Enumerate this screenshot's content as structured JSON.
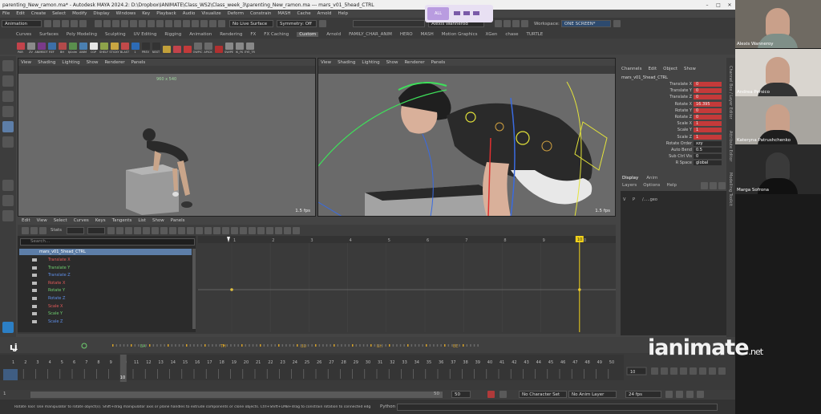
{
  "app": {
    "title": "parenting_New_ramon.ma* - Autodesk MAYA 2024.2: D:\\Dropbox\\IANIMATE\\Class_WS2\\Class_week_3\\parenting_New_ramon.ma --- mars_v01_5head_CTRL"
  },
  "menubar": [
    "File",
    "Edit",
    "Create",
    "Select",
    "Modify",
    "Display",
    "Windows",
    "Key",
    "Playback",
    "Audio",
    "Visualize",
    "Deform",
    "Constrain",
    "MASH",
    "Cache",
    "Arnold",
    "Help"
  ],
  "statusline": {
    "mode": "Animation",
    "live_surface": "No Live Surface",
    "symmetry": "Symmetry: Off",
    "user": "Alexis Wannerod",
    "workspace_label": "Workspace:",
    "workspace": "ONE SCREEN*"
  },
  "overlay": {
    "label": "ALL"
  },
  "shelf_tabs": [
    "Curves",
    "Surfaces",
    "Poly Modeling",
    "Sculpting",
    "UV Editing",
    "Rigging",
    "Animation",
    "Rendering",
    "FX",
    "FX Caching",
    "Custom",
    "Arnold",
    "FAMILY_CHAR_ANIM",
    "HERO",
    "MASH",
    "Motion Graphics",
    "XGen",
    "chase",
    "TURTLE"
  ],
  "active_shelf": "Custom",
  "shelf_icons": [
    {
      "label": "PAR",
      "color": "#c2434b"
    },
    {
      "label": "ZV",
      "color": "#8a8a8a"
    },
    {
      "label": "ANIMBOT",
      "color": "#7a3a8a"
    },
    {
      "label": "REF",
      "color": "#3d6fa8"
    },
    {
      "label": "BH",
      "color": "#b24a4a"
    },
    {
      "label": "tjAnim",
      "color": "#5a8f4d"
    },
    {
      "label": "ANIM",
      "color": "#4a7fb0"
    },
    {
      "label": "CGP",
      "color": "#e6e6e6"
    },
    {
      "label": "SHELF",
      "color": "#8ea34a"
    },
    {
      "label": "STICKY",
      "color": "#c9a642"
    },
    {
      "label": "BLAST",
      "color": "#c14a4a"
    },
    {
      "label": "1",
      "color": "#2d6bb5"
    },
    {
      "label": "PREV",
      "color": "#333333"
    },
    {
      "label": "NEXT",
      "color": "#333333"
    },
    {
      "label": "",
      "color": "#c2a03a"
    },
    {
      "label": "",
      "color": "#c2434b"
    },
    {
      "label": "",
      "color": "#c23a3a"
    },
    {
      "label": "OWPIC",
      "color": "#6a6a6a"
    },
    {
      "label": "APICK",
      "color": "#6a6a6a"
    },
    {
      "label": "",
      "color": "#b03030"
    },
    {
      "label": "SWIPE",
      "color": "#888888"
    },
    {
      "label": "IK_FK",
      "color": "#888888"
    },
    {
      "label": "EYE_TR",
      "color": "#888888"
    }
  ],
  "viewport_menu": [
    "View",
    "Shading",
    "Lighting",
    "Show",
    "Renderer",
    "Panels"
  ],
  "viewport_left": {
    "resolution": "960 x 540",
    "fps": "1.5 fps"
  },
  "viewport_right": {
    "fps": "1.5 fps"
  },
  "graph_editor": {
    "menu": [
      "Edit",
      "View",
      "Select",
      "Curves",
      "Keys",
      "Tangents",
      "List",
      "Show",
      "Panels"
    ],
    "stats_label": "Stats",
    "search_placeholder": "Search...",
    "object": "mars_v01_5head_CTRL",
    "channels": [
      {
        "name": "Translate X",
        "color": "#e35a5a"
      },
      {
        "name": "Translate Y",
        "color": "#6fcf6f"
      },
      {
        "name": "Translate Z",
        "color": "#5f8fe8"
      },
      {
        "name": "Rotate X",
        "color": "#e35a5a"
      },
      {
        "name": "Rotate Y",
        "color": "#6fcf6f"
      },
      {
        "name": "Rotate Z",
        "color": "#5f8fe8"
      },
      {
        "name": "Scale X",
        "color": "#e35a5a"
      },
      {
        "name": "Scale Y",
        "color": "#6fcf6f"
      },
      {
        "name": "Scale Z",
        "color": "#5f8fe8"
      }
    ],
    "frame_marks": [
      "1",
      "2",
      "3",
      "4",
      "5",
      "6",
      "7",
      "8",
      "9",
      "10"
    ],
    "current_frame": "10"
  },
  "channel_box": {
    "menu": [
      "Channels",
      "Edit",
      "Object",
      "Show"
    ],
    "object": "mars_v01_5head_CTRL",
    "attrs": [
      {
        "name": "Translate X",
        "value": "0",
        "keyed": true
      },
      {
        "name": "Translate Y",
        "value": "0",
        "keyed": true
      },
      {
        "name": "Translate Z",
        "value": "0",
        "keyed": true
      },
      {
        "name": "Rotate X",
        "value": "16.395",
        "keyed": true
      },
      {
        "name": "Rotate Y",
        "value": "0",
        "keyed": true
      },
      {
        "name": "Rotate Z",
        "value": "0",
        "keyed": true
      },
      {
        "name": "Scale X",
        "value": "1",
        "keyed": true
      },
      {
        "name": "Scale Y",
        "value": "1",
        "keyed": true
      },
      {
        "name": "Scale Z",
        "value": "1",
        "keyed": true
      },
      {
        "name": "Rotate Order",
        "value": "xzy",
        "keyed": false
      },
      {
        "name": "Auto Bend",
        "value": "0.5",
        "keyed": false
      },
      {
        "name": "Sub Ctrl Vis",
        "value": "0",
        "keyed": false
      },
      {
        "name": "R Space",
        "value": "global",
        "keyed": false
      }
    ],
    "layer_tabs": [
      "Display",
      "Anim"
    ],
    "layer_menu": [
      "Layers",
      "Options",
      "Help"
    ],
    "layer_row": {
      "v": "V",
      "p": "P",
      "name": "/.....geo"
    }
  },
  "timeline": {
    "markers": [
      {
        "label": "EA",
        "color": "#6fcf6f"
      },
      {
        "label": "TH",
        "color": "#d4a02a"
      },
      {
        "label": "BD",
        "color": "#d4a02a"
      },
      {
        "label": "BH",
        "color": "#d4a02a"
      },
      {
        "label": "BE",
        "color": "#d4a02a"
      }
    ],
    "ticks": [
      "1",
      "2",
      "3",
      "4",
      "5",
      "6",
      "7",
      "8",
      "9",
      "10",
      "11",
      "12",
      "13",
      "14",
      "15",
      "16",
      "17",
      "18",
      "19",
      "20",
      "21",
      "22",
      "23",
      "24",
      "25",
      "26",
      "27",
      "28",
      "29",
      "30",
      "31",
      "32",
      "33",
      "34",
      "35",
      "36",
      "37",
      "38",
      "39",
      "40",
      "41",
      "42",
      "43",
      "44",
      "45",
      "46",
      "47",
      "48",
      "49",
      "50"
    ],
    "current_frame": "10",
    "current_field": "10"
  },
  "range": {
    "start": "1",
    "start_inner": "1",
    "end_inner": "50",
    "end": "50",
    "character_set": "No Character Set",
    "anim_layer": "No Anim Layer",
    "fps": "24 fps"
  },
  "help": {
    "text": "Rotate Tool: Use manipulator to rotate object(s). Shift+drag manipulator axis or plane handles to extrude components or clone objects. Ctrl+Shift+LMB+drag to constrain rotation to connected edges. Use D or INSE",
    "language": "Python"
  },
  "side_tabs": [
    "Channel Box / Layer Editor",
    "Attribute Editor",
    "Modelling Toolkit"
  ],
  "participants": [
    {
      "name": "Alexis Wanneroy",
      "bg": "#6f6a62"
    },
    {
      "name": "Andrea Persico",
      "bg": "#d9d5cf"
    },
    {
      "name": "Kateryna Patrushchenko",
      "bg": "#a8a59f"
    },
    {
      "name": "Marga Sofrona",
      "bg": "#2a2a2a"
    }
  ],
  "watermark": {
    "main": "ianimate",
    "tld": ".net"
  },
  "colors": {
    "accent": "#5d7ea8",
    "keyed": "#c43a3a",
    "current_time": "#f2d21a"
  }
}
